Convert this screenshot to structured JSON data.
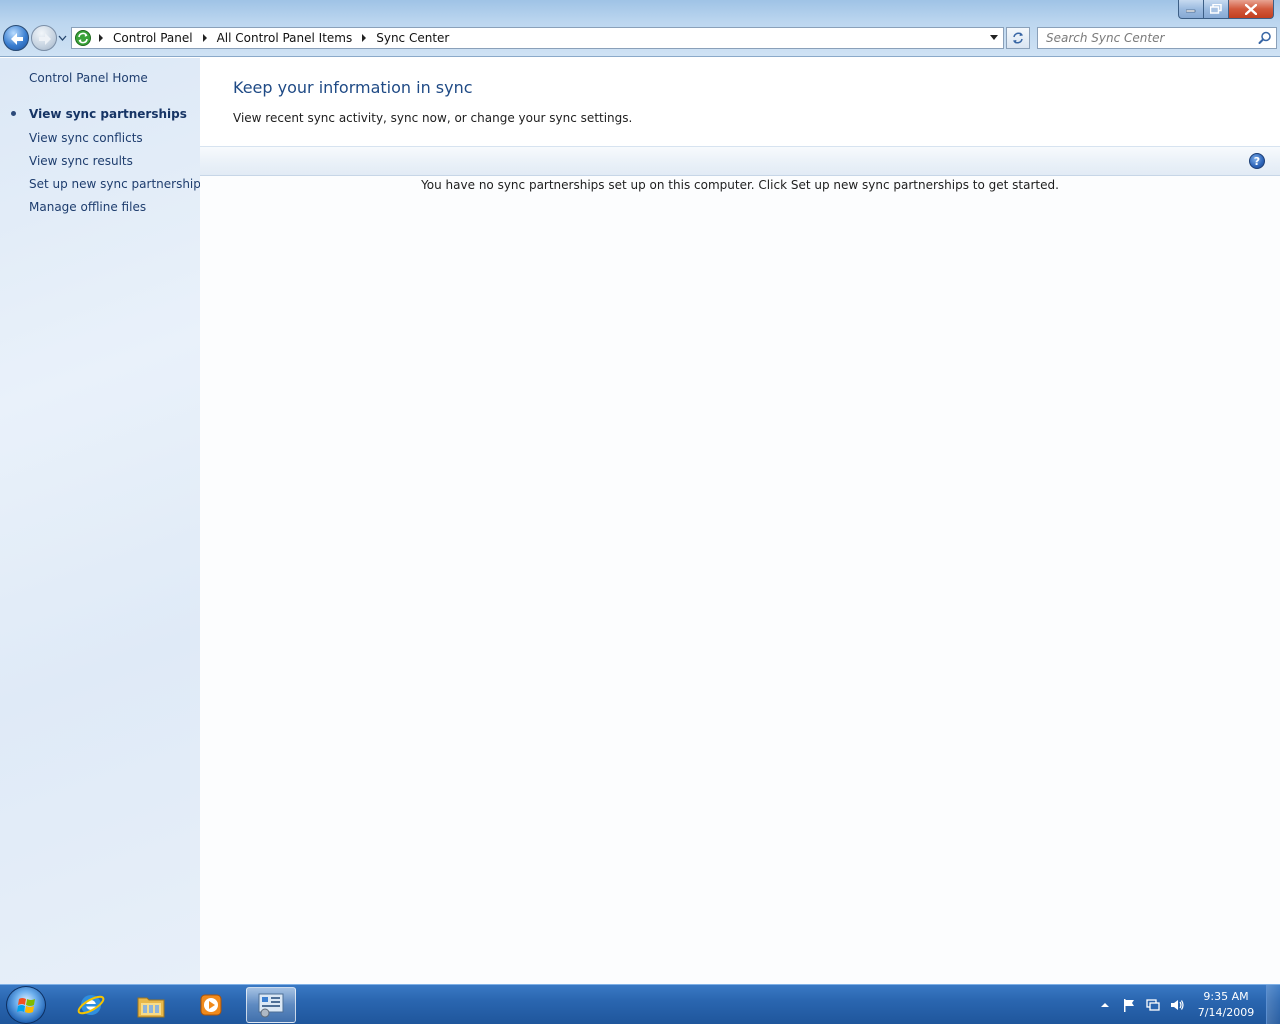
{
  "window": {
    "controls": [
      "minimize-icon",
      "maximize-icon",
      "close-icon"
    ]
  },
  "address_bar": {
    "icon": "sync-center-icon",
    "breadcrumbs": [
      "Control Panel",
      "All Control Panel Items",
      "Sync Center"
    ]
  },
  "search": {
    "placeholder": "Search Sync Center"
  },
  "left_pane": {
    "home_link": "Control Panel Home",
    "items": [
      {
        "label": "View sync partnerships",
        "active": true
      },
      {
        "label": "View sync conflicts",
        "active": false
      },
      {
        "label": "View sync results",
        "active": false
      },
      {
        "label": "Set up new sync partnerships",
        "active": false
      },
      {
        "label": "Manage offline files",
        "active": false
      }
    ]
  },
  "main": {
    "title": "Keep your information in sync",
    "description": "View recent sync activity, sync now, or change your sync settings.",
    "help_label": "?",
    "empty_message": "You have no sync partnerships set up on this computer. Click Set up new sync partnerships to get started."
  },
  "taskbar": {
    "pinned": [
      "internet-explorer-icon",
      "windows-explorer-icon",
      "media-player-icon",
      "control-panel-icon"
    ],
    "active": "control-panel-icon",
    "tray": [
      "show-hidden-icons-icon",
      "action-center-flag-icon",
      "network-icon",
      "volume-icon"
    ],
    "time": "9:35 AM",
    "date": "7/14/2009"
  },
  "colors": {
    "link": "#1e3d6e",
    "title": "#1f4a85",
    "taskbar": "#2a66b0",
    "close_button": "#c23f1f"
  }
}
